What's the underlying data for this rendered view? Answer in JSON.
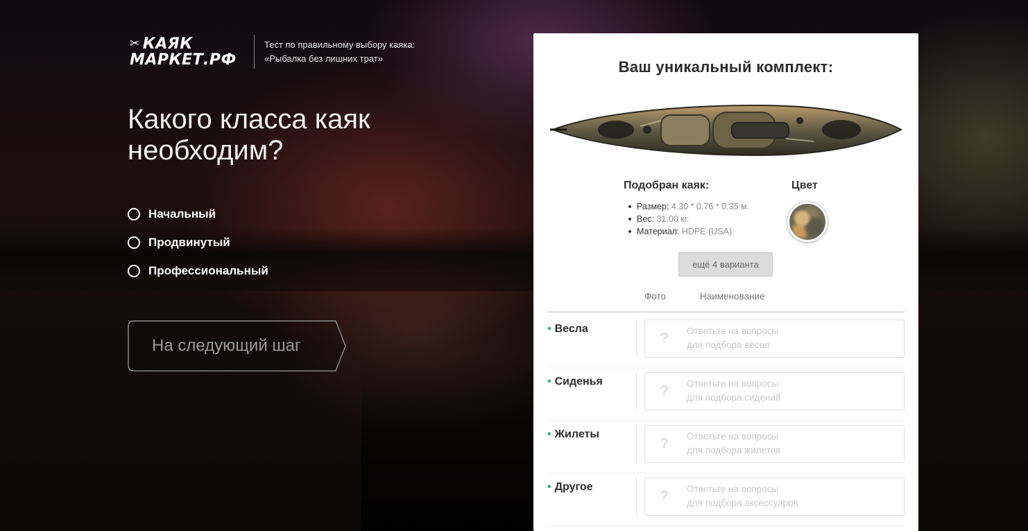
{
  "brand": {
    "logo_line1": "КАЯК",
    "logo_line2": "МАРКЕТ.РФ",
    "tagline_line1": "Тест по правильному выбору каяка:",
    "tagline_line2": "«Рыбалка без лишних трат»"
  },
  "quiz": {
    "question": "Какого класса каяк необходим?",
    "options": [
      {
        "label": "Начальный",
        "selected": false
      },
      {
        "label": "Продвинутый",
        "selected": false
      },
      {
        "label": "Профессиональный",
        "selected": false
      }
    ],
    "next_button": "На следующий шаг"
  },
  "panel": {
    "title": "Ваш уникальный комплект:",
    "kayak_title": "Подобран каяк:",
    "specs": [
      {
        "label": "Размер:",
        "value": "4.30 * 0.76 * 0.35 м."
      },
      {
        "label": "Вес:",
        "value": "31.00 кг."
      },
      {
        "label": "Материал:",
        "value": "HDPE (USA)"
      }
    ],
    "color_title": "Цвет",
    "more_button": "ещё 4 варианта",
    "table_headers": {
      "photo": "Фото",
      "name": "Наименование"
    },
    "rows": [
      {
        "label": "Весла",
        "placeholder_line1": "Ответьте на вопросы",
        "placeholder_line2": "для подбора вёсел"
      },
      {
        "label": "Сиденья",
        "placeholder_line1": "Ответьте на вопросы",
        "placeholder_line2": "для подбора сидений"
      },
      {
        "label": "Жилеты",
        "placeholder_line1": "Ответьте на вопросы",
        "placeholder_line2": "для подбора жилетов"
      },
      {
        "label": "Другое",
        "placeholder_line1": "Ответьте на вопросы",
        "placeholder_line2": "для подбора аксессуаров"
      }
    ],
    "placeholder_icon": "?",
    "bullet_color": "#2fb87b",
    "logo_watermark": "КАЯК МАРКЕТ.РФ"
  }
}
